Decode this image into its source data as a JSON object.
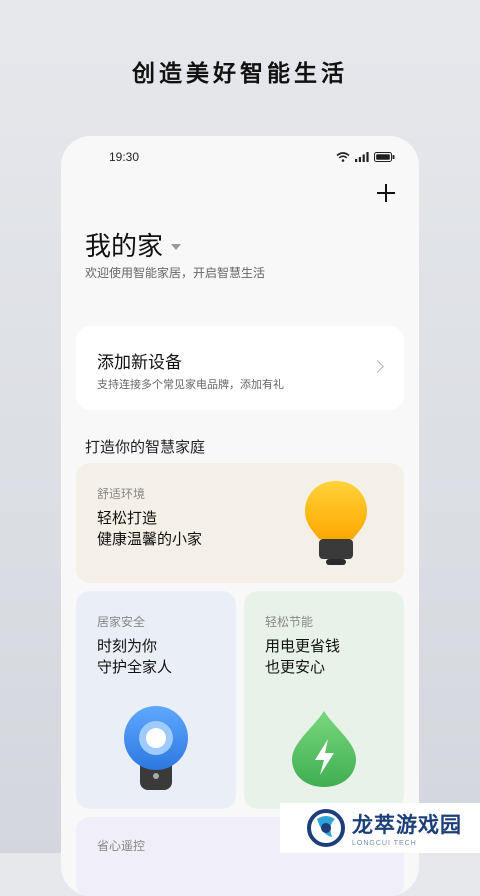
{
  "promo": {
    "headline": "创造美好智能生活"
  },
  "status_bar": {
    "time": "19:30"
  },
  "home": {
    "title": "我的家",
    "subtitle": "欢迎使用智能家居，开启智慧生活"
  },
  "add_device": {
    "title": "添加新设备",
    "subtitle": "支持连接多个常见家电品牌，添加有礼"
  },
  "section": {
    "title": "打造你的智慧家庭"
  },
  "cards": {
    "comfort": {
      "label": "舒适环境",
      "line1": "轻松打造",
      "line2": "健康温馨的小家",
      "icon": "lightbulb-icon"
    },
    "safety": {
      "label": "居家安全",
      "line1": "时刻为你",
      "line2": "守护全家人",
      "icon": "security-camera-icon"
    },
    "energy": {
      "label": "轻松节能",
      "line1": "用电更省钱",
      "line2": "也更安心",
      "icon": "energy-drop-icon"
    },
    "remote": {
      "label": "省心遥控"
    }
  },
  "watermark": {
    "name": "龙萃游戏园",
    "tagline": "LONGCUI TECH"
  },
  "colors": {
    "comfort_bg": "#f5f0e7",
    "safety_bg": "#eaeef6",
    "energy_bg": "#e9f2e9",
    "remote_bg": "#f0eef8",
    "bulb": "#ffb300",
    "camera": "#3d8ef0",
    "drop": "#5cc36a"
  }
}
